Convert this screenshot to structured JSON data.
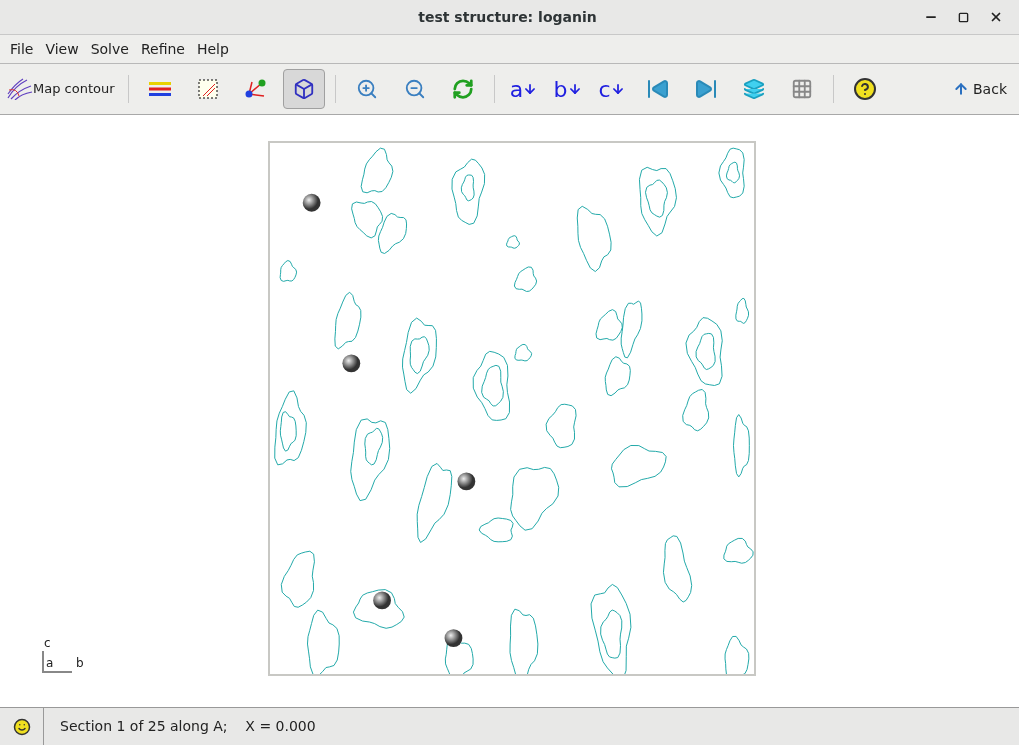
{
  "window": {
    "title": "test structure: loganin"
  },
  "menu": [
    "File",
    "View",
    "Solve",
    "Refine",
    "Help"
  ],
  "toolbar": [
    {
      "kind": "labeled",
      "label": "Map contour",
      "selected": false
    },
    {
      "kind": "separator"
    },
    {
      "kind": "icon",
      "selected": false
    },
    {
      "kind": "icon",
      "selected": false
    },
    {
      "kind": "icon",
      "selected": false
    },
    {
      "kind": "icon",
      "selected": true
    },
    {
      "kind": "separator"
    },
    {
      "kind": "icon",
      "selected": false
    },
    {
      "kind": "icon",
      "selected": false
    },
    {
      "kind": "icon",
      "selected": false
    },
    {
      "kind": "separator"
    },
    {
      "kind": "axis",
      "label": "a",
      "selected": false
    },
    {
      "kind": "axis",
      "label": "b",
      "selected": false
    },
    {
      "kind": "axis",
      "label": "c",
      "selected": false
    },
    {
      "kind": "icon",
      "selected": false
    },
    {
      "kind": "icon",
      "selected": false
    },
    {
      "kind": "icon",
      "selected": false
    },
    {
      "kind": "icon",
      "selected": false
    },
    {
      "kind": "separator"
    },
    {
      "kind": "icon",
      "selected": false
    }
  ],
  "back_button": {
    "label": "Back"
  },
  "axes": {
    "vertical": "c",
    "origin": "a",
    "horizontal": "b"
  },
  "status_bar": {
    "text": "Section 1 of 25 along A;    X = 0.000"
  }
}
